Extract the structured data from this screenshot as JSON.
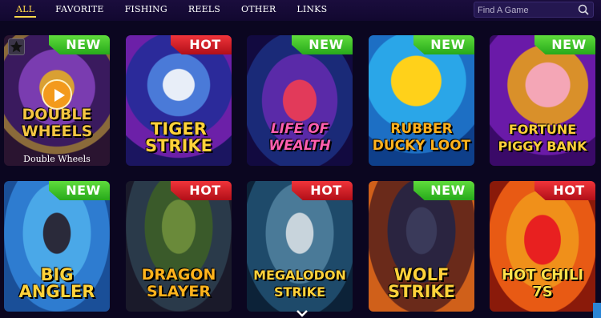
{
  "tabs": [
    {
      "label": "ALL",
      "active": true
    },
    {
      "label": "FAVORITE",
      "active": false
    },
    {
      "label": "FISHING",
      "active": false
    },
    {
      "label": "REELS",
      "active": false
    },
    {
      "label": "OTHER",
      "active": false
    },
    {
      "label": "LINKS",
      "active": false
    }
  ],
  "search": {
    "placeholder": "Find A Game",
    "icon": "search-icon"
  },
  "games": [
    {
      "logo": "DOUBLE WHEELS",
      "badge": "NEW",
      "caption": "Double Wheels",
      "hovered": true,
      "logo_color": "#f5c542"
    },
    {
      "logo": "TIGER STRIKE",
      "badge": "HOT",
      "logo_color": "#ffd23a"
    },
    {
      "logo": "LIFE OF WEALTH",
      "badge": "NEW",
      "logo_color": "#ff5fb0"
    },
    {
      "logo": "RUBBER DUCKY LOOT",
      "badge": "NEW",
      "logo_color": "#ffb21e"
    },
    {
      "logo": "FORTUNE PIGGY BANK",
      "badge": "NEW",
      "logo_color": "#ffcf3a"
    },
    {
      "logo": "BIG ANGLER",
      "badge": "NEW",
      "logo_color": "#ffd23a"
    },
    {
      "logo": "DRAGON SLAYER",
      "badge": "HOT",
      "logo_color": "#ffb31c"
    },
    {
      "logo": "MEGALODON STRIKE",
      "badge": "HOT",
      "logo_color": "#ffd23a"
    },
    {
      "logo": "WOLF STRIKE",
      "badge": "NEW",
      "logo_color": "#ffd23a"
    },
    {
      "logo": "HOT CHILI 7S",
      "badge": "HOT",
      "logo_color": "#ffe24a"
    }
  ],
  "colors": {
    "accent": "#ffd84a",
    "new_badge": "#3cc22a",
    "hot_badge": "#e0222b",
    "background": "#0b0620"
  }
}
